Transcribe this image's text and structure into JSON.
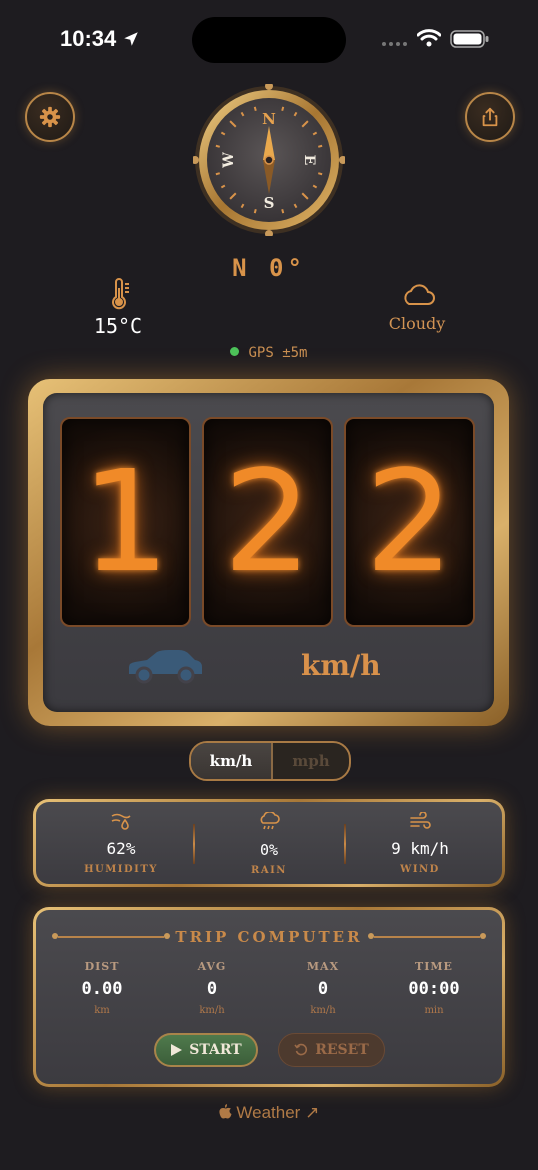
{
  "status_bar": {
    "time": "10:34",
    "icons": [
      "location-arrow-icon",
      "signal-dots-icon",
      "wifi-icon",
      "battery-icon"
    ]
  },
  "header": {
    "settings_icon": "gear-icon",
    "share_icon": "share-icon"
  },
  "compass": {
    "n": "N",
    "s": "S",
    "e": "E",
    "w": "W",
    "heading_text": "N 0°",
    "heading_degrees": 0
  },
  "weather": {
    "temperature": "15°C",
    "condition": "Cloudy",
    "gps": "GPS ±5m",
    "gps_status_color": "#4cc35a"
  },
  "speedometer": {
    "digits": [
      "1",
      "2",
      "2"
    ],
    "unit": "km/h",
    "accent_color": "#f08a28"
  },
  "unit_toggle": {
    "options": [
      "km/h",
      "mph"
    ],
    "selected": "km/h"
  },
  "weather_panel": {
    "humidity": {
      "value": "62%",
      "label": "HUMIDITY",
      "icon": "humidity-icon"
    },
    "rain": {
      "value": "0%",
      "label": "RAIN",
      "icon": "rain-cloud-icon"
    },
    "wind": {
      "value": "9 km/h",
      "label": "WIND",
      "icon": "wind-icon"
    }
  },
  "trip_computer": {
    "title": "TRIP COMPUTER",
    "stats": [
      {
        "label": "DIST",
        "value": "0.00",
        "unit": "km"
      },
      {
        "label": "AVG",
        "value": "0",
        "unit": "km/h"
      },
      {
        "label": "MAX",
        "value": "0",
        "unit": "km/h"
      },
      {
        "label": "TIME",
        "value": "00:00",
        "unit": "min"
      }
    ],
    "start_label": "START",
    "reset_label": "RESET"
  },
  "footer": {
    "text": " Weather ↗",
    "brand": "Weather",
    "arrow": "↗"
  }
}
